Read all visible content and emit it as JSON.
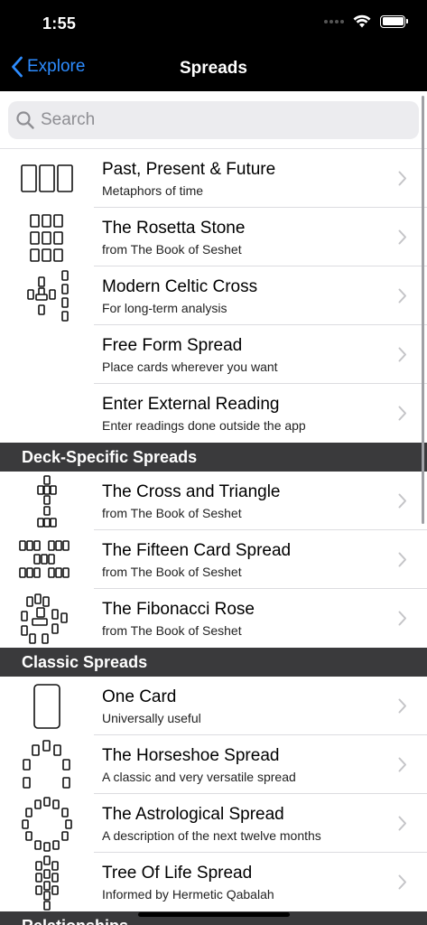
{
  "status_bar": {
    "time": "1:55"
  },
  "nav": {
    "back_label": "Explore",
    "title": "Spreads"
  },
  "search": {
    "placeholder": "Search",
    "value": ""
  },
  "top_items": [
    {
      "title": "Past, Present & Future",
      "subtitle": "Metaphors of time",
      "icon": "three-card-spread-icon"
    },
    {
      "title": "The Rosetta Stone",
      "subtitle": "from The Book of Seshet",
      "icon": "rosetta-stone-spread-icon"
    },
    {
      "title": "Modern Celtic Cross",
      "subtitle": "For long-term analysis",
      "icon": "celtic-cross-spread-icon"
    },
    {
      "title": "Free Form Spread",
      "subtitle": "Place cards wherever you want",
      "icon": ""
    },
    {
      "title": "Enter External Reading",
      "subtitle": "Enter readings done outside the app",
      "icon": ""
    }
  ],
  "sections": [
    {
      "header": "Deck-Specific Spreads",
      "items": [
        {
          "title": "The Cross and Triangle",
          "subtitle": "from The Book of Seshet",
          "icon": "cross-and-triangle-spread-icon"
        },
        {
          "title": "The Fifteen Card Spread",
          "subtitle": "from The Book of Seshet",
          "icon": "fifteen-card-spread-icon"
        },
        {
          "title": "The Fibonacci Rose",
          "subtitle": "from The Book of Seshet",
          "icon": "fibonacci-rose-spread-icon"
        }
      ]
    },
    {
      "header": "Classic Spreads",
      "items": [
        {
          "title": "One Card",
          "subtitle": "Universally useful",
          "icon": "one-card-spread-icon"
        },
        {
          "title": "The Horseshoe Spread",
          "subtitle": "A classic and very versatile spread",
          "icon": "horseshoe-spread-icon"
        },
        {
          "title": "The Astrological Spread",
          "subtitle": "A description of the next twelve months",
          "icon": "astrological-spread-icon"
        },
        {
          "title": "Tree Of Life Spread",
          "subtitle": "Informed by Hermetic Qabalah",
          "icon": "tree-of-life-spread-icon"
        }
      ]
    },
    {
      "header": "Relationships",
      "items": []
    }
  ],
  "colors": {
    "nav_background": "#000000",
    "accent": "#2d8cff",
    "section_header": "#3a3a3c",
    "chevron": "#c4c4c7"
  }
}
